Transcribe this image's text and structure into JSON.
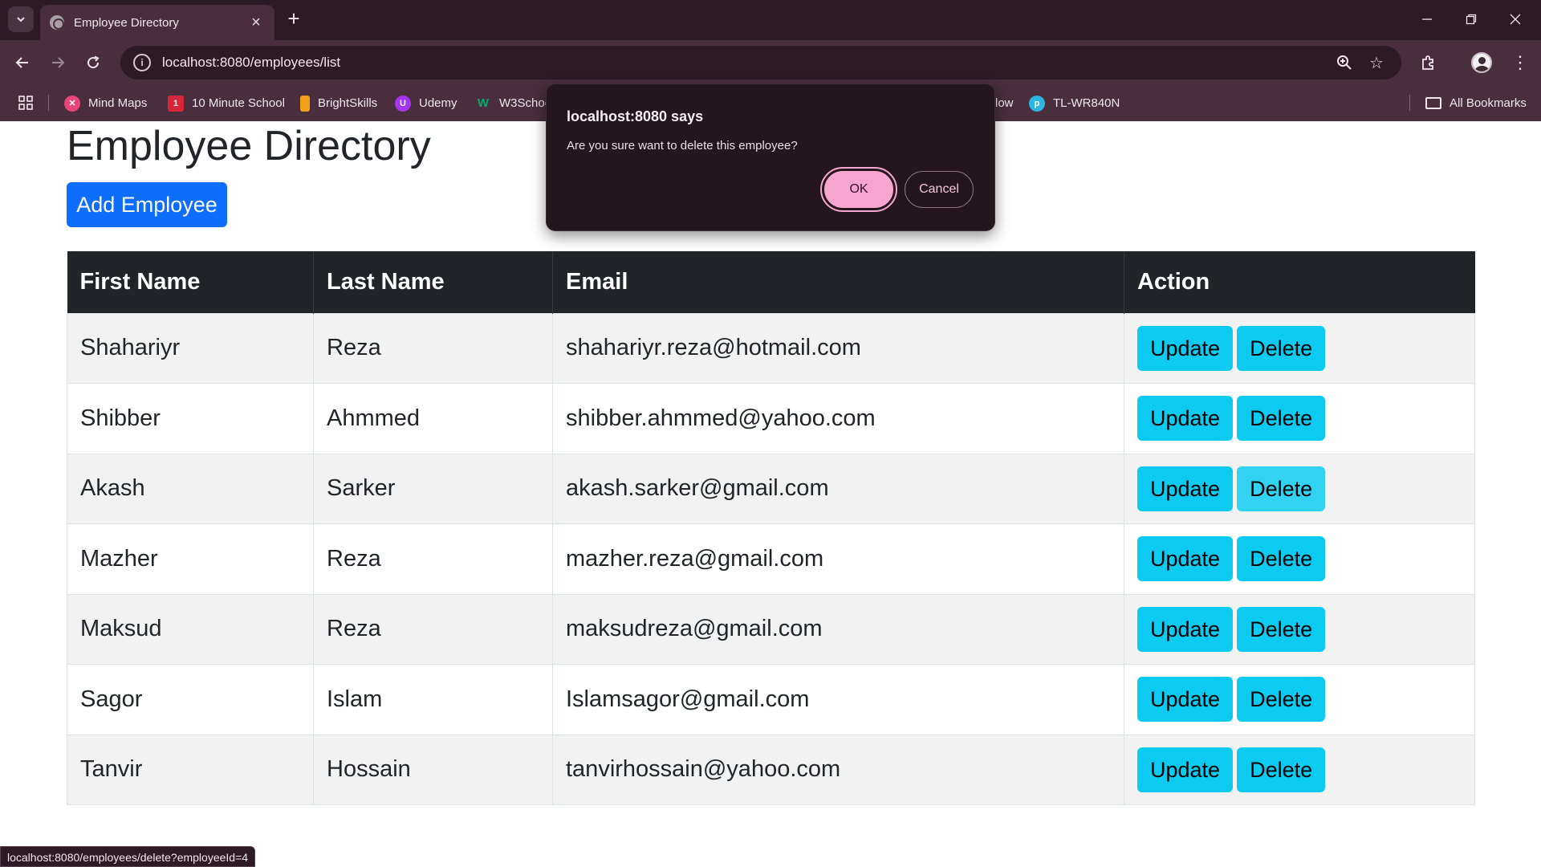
{
  "browser": {
    "tab_title": "Employee Directory",
    "url": "localhost:8080/employees/list",
    "bookmarks": [
      {
        "label": "Mind Maps",
        "color": "#e8457a"
      },
      {
        "label": "10 Minute School",
        "color": "#d6263b"
      },
      {
        "label": "BrightSkills",
        "color": "#f4a11a"
      },
      {
        "label": "Udemy",
        "color": "#a435f0"
      },
      {
        "label": "W3Schoo",
        "color": "#04aa6d"
      },
      {
        "label": "low",
        "color": ""
      },
      {
        "label": "TL-WR840N",
        "color": "#2bb5e0"
      }
    ],
    "all_bookmarks": "All Bookmarks",
    "status_url": "localhost:8080/employees/delete?employeeId=4"
  },
  "page": {
    "title": "Employee Directory",
    "add_button": "Add Employee",
    "columns": [
      "First Name",
      "Last Name",
      "Email",
      "Action"
    ],
    "rows": [
      {
        "first": "Shahariyr",
        "last": "Reza",
        "email": "shahariyr.reza@hotmail.com"
      },
      {
        "first": "Shibber",
        "last": "Ahmmed",
        "email": "shibber.ahmmed@yahoo.com"
      },
      {
        "first": "Akash",
        "last": "Sarker",
        "email": "akash.sarker@gmail.com"
      },
      {
        "first": "Mazher",
        "last": "Reza",
        "email": "mazher.reza@gmail.com"
      },
      {
        "first": "Maksud",
        "last": "Reza",
        "email": "maksudreza@gmail.com"
      },
      {
        "first": "Sagor",
        "last": "Islam",
        "email": "Islamsagor@gmail.com"
      },
      {
        "first": "Tanvir",
        "last": "Hossain",
        "email": "tanvirhossain@yahoo.com"
      }
    ],
    "update_label": "Update",
    "delete_label": "Delete"
  },
  "dialog": {
    "title": "localhost:8080 says",
    "message": "Are you sure want to delete this employee?",
    "ok": "OK",
    "cancel": "Cancel"
  },
  "colors": {
    "primary": "#0d6efd",
    "info": "#0dcaf0",
    "header_dark": "#212529",
    "chrome": "#4a2e3d"
  }
}
